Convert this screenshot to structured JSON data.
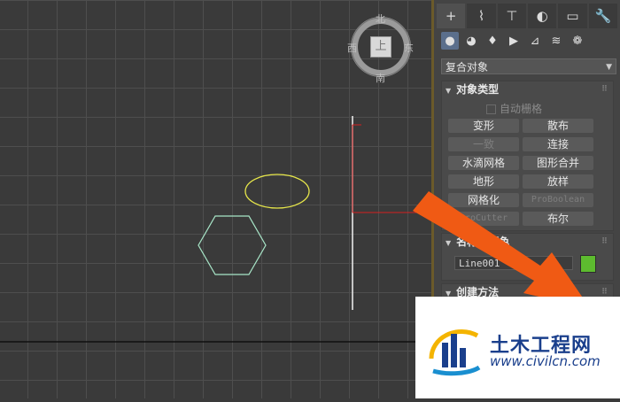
{
  "viewcube": {
    "north": "北",
    "south": "南",
    "east": "东",
    "west": "西",
    "face": "上"
  },
  "toolbar": {
    "tabs": [
      {
        "icon": "plus-icon",
        "glyph": "+"
      },
      {
        "icon": "modify-curve-icon",
        "glyph": "⌇"
      },
      {
        "icon": "hierarchy-icon",
        "glyph": "⊤"
      },
      {
        "icon": "motion-icon",
        "glyph": "◐"
      },
      {
        "icon": "display-icon",
        "glyph": "▭"
      },
      {
        "icon": "wrench-icon",
        "glyph": "🔧"
      }
    ],
    "categories": [
      {
        "icon": "sphere-icon",
        "glyph": "●"
      },
      {
        "icon": "shapes-icon",
        "glyph": "◕"
      },
      {
        "icon": "light-icon",
        "glyph": "♦"
      },
      {
        "icon": "camera-icon",
        "glyph": "▶"
      },
      {
        "icon": "helper-icon",
        "glyph": "⊿"
      },
      {
        "icon": "spacewarp-icon",
        "glyph": "≋"
      },
      {
        "icon": "systems-icon",
        "glyph": "❁"
      }
    ]
  },
  "dropdown": {
    "value": "复合对象"
  },
  "object_type": {
    "title": "对象类型",
    "autogrid": "自动栅格",
    "buttons": [
      {
        "label": "变形",
        "enabled": true
      },
      {
        "label": "散布",
        "enabled": true
      },
      {
        "label": "一致",
        "enabled": false
      },
      {
        "label": "连接",
        "enabled": true
      },
      {
        "label": "水滴网格",
        "enabled": true
      },
      {
        "label": "图形合并",
        "enabled": true
      },
      {
        "label": "地形",
        "enabled": true
      },
      {
        "label": "放样",
        "enabled": true
      },
      {
        "label": "网格化",
        "enabled": true
      },
      {
        "label": "ProBoolean",
        "enabled": false
      },
      {
        "label": "ProCutter",
        "enabled": false
      },
      {
        "label": "布尔",
        "enabled": true
      }
    ]
  },
  "name_color": {
    "title": "名称和颜色",
    "name_value": "Line001",
    "swatch_color": "#5dbb2f"
  },
  "creation_method": {
    "title": "创建方法"
  },
  "watermark": {
    "title": "土木工程网",
    "url": "www.civilcn.com"
  },
  "colors": {
    "arrow": "#f05a14",
    "ellipse": "#e6e64a",
    "hexagon": "#a8e6c8",
    "axis_red": "#d42020"
  }
}
